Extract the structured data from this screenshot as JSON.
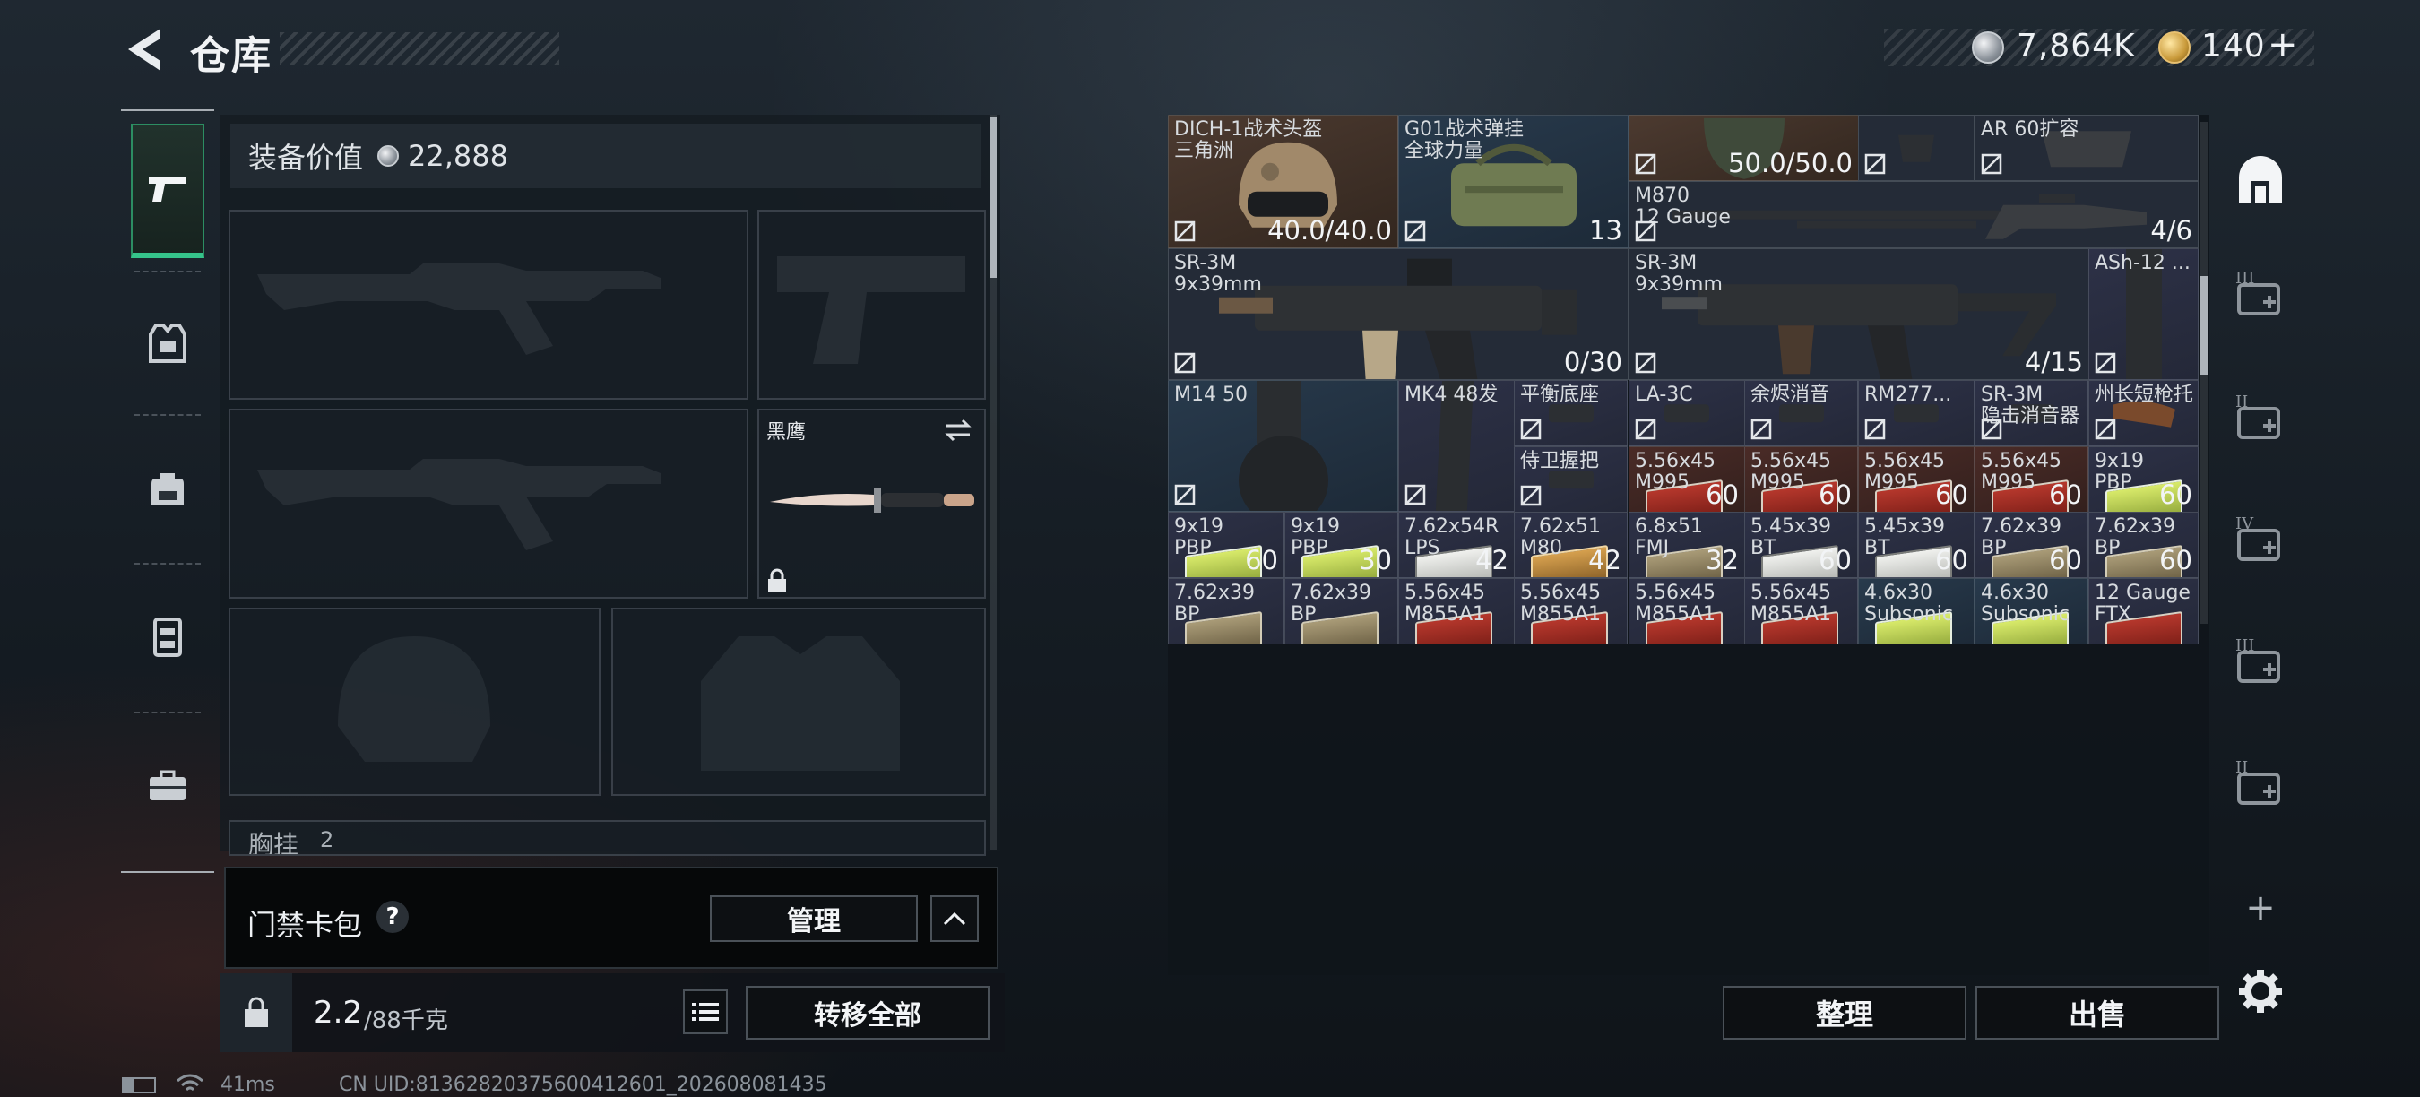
{
  "header": {
    "title": "仓库",
    "currency_silver": "7,864K",
    "currency_gold": "140",
    "currency_gold_add": "+"
  },
  "tabs": [
    {
      "name": "weapons",
      "icon": "pistol-icon"
    },
    {
      "name": "armor",
      "icon": "vest-icon"
    },
    {
      "name": "backpack",
      "icon": "backpack-icon"
    },
    {
      "name": "rig",
      "icon": "chest-rig-icon"
    },
    {
      "name": "case",
      "icon": "briefcase-icon"
    }
  ],
  "loadout": {
    "equipment_value_label": "装备价值",
    "equipment_value": "22,888",
    "melee_label": "黑鹰",
    "chest_rig_label": "胸挂",
    "chest_rig_count": "2",
    "keycard_label": "门禁卡包",
    "keycard_help": "?",
    "manage_label": "管理",
    "weight_current": "2.2",
    "weight_max": "/88千克",
    "transfer_all_label": "转移全部"
  },
  "stash": {
    "items": [
      {
        "name": "DICH-1战术头盔\n三角洲",
        "qty": "40.0/40.0",
        "rarity": "brown",
        "art": "helmet"
      },
      {
        "name": "G01战术弹挂\n全球力量",
        "qty": "13",
        "rarity": "blue",
        "art": "bag"
      },
      {
        "name": "",
        "qty": "50.0/50.0",
        "rarity": "brown",
        "art": "mask"
      },
      {
        "name": "",
        "qty": "",
        "rarity": "gray",
        "art": "grip"
      },
      {
        "name": "AR 60扩容",
        "qty": "",
        "rarity": "gray",
        "art": "mag"
      },
      {
        "name": "M870\n12 Gauge",
        "qty": "4/6",
        "rarity": "gray",
        "art": "shotgun"
      },
      {
        "name": "SR-3M\n9x39mm",
        "qty": "0/30",
        "rarity": "gray",
        "art": "rifle"
      },
      {
        "name": "SR-3M\n9x39mm",
        "qty": "4/15",
        "rarity": "gray",
        "art": "rifle2"
      },
      {
        "name": "ASh-12 ...",
        "qty": "",
        "rarity": "purple",
        "art": "mag2"
      },
      {
        "name": "M14 50",
        "qty": "",
        "rarity": "blue",
        "art": "drum"
      },
      {
        "name": "MK4 48发",
        "qty": "",
        "rarity": "purple",
        "art": "longmag"
      },
      {
        "name": "平衡底座",
        "qty": "",
        "rarity": "purple",
        "art": "part"
      },
      {
        "name": "LA-3C",
        "qty": "",
        "rarity": "purple",
        "art": "part"
      },
      {
        "name": "余烬消音",
        "qty": "",
        "rarity": "purple",
        "art": "part"
      },
      {
        "name": "RM277...",
        "qty": "",
        "rarity": "purple",
        "art": "part"
      },
      {
        "name": "SR-3M\n隐击消音器",
        "qty": "",
        "rarity": "purple",
        "art": "part"
      },
      {
        "name": "州长短枪托",
        "qty": "",
        "rarity": "purple",
        "art": "stock"
      },
      {
        "name": "侍卫握把",
        "qty": "",
        "rarity": "purple",
        "art": "part"
      },
      {
        "name": "5.56x45\nM995",
        "qty": "60",
        "rarity": "red",
        "art": "ammo-red"
      },
      {
        "name": "5.56x45\nM995",
        "qty": "60",
        "rarity": "red",
        "art": "ammo-red"
      },
      {
        "name": "5.56x45\nM995",
        "qty": "60",
        "rarity": "red",
        "art": "ammo-red"
      },
      {
        "name": "5.56x45\nM995",
        "qty": "60",
        "rarity": "red",
        "art": "ammo-red"
      },
      {
        "name": "9x19\nPBP",
        "qty": "60",
        "rarity": "purple",
        "art": "ammo-green"
      },
      {
        "name": "9x19\nPBP",
        "qty": "60",
        "rarity": "purple",
        "art": "ammo-green"
      },
      {
        "name": "9x19\nPBP",
        "qty": "30",
        "rarity": "purple",
        "art": "ammo-green"
      },
      {
        "name": "7.62x54R\nLPS",
        "qty": "42",
        "rarity": "purple",
        "art": "ammo-white"
      },
      {
        "name": "7.62x51\nM80",
        "qty": "42",
        "rarity": "purple",
        "art": "ammo-gold"
      },
      {
        "name": "6.8x51\nFMJ",
        "qty": "32",
        "rarity": "purple",
        "art": "ammo-tan"
      },
      {
        "name": "5.45x39\nBT",
        "qty": "60",
        "rarity": "purple",
        "art": "ammo-white"
      },
      {
        "name": "5.45x39\nBT",
        "qty": "60",
        "rarity": "purple",
        "art": "ammo-white"
      },
      {
        "name": "7.62x39\nBP",
        "qty": "60",
        "rarity": "purple",
        "art": "ammo-tan"
      },
      {
        "name": "7.62x39\nBP",
        "qty": "60",
        "rarity": "purple",
        "art": "ammo-tan"
      },
      {
        "name": "7.62x39\nBP",
        "qty": "",
        "rarity": "purple",
        "art": "ammo-tan"
      },
      {
        "name": "7.62x39\nBP",
        "qty": "",
        "rarity": "purple",
        "art": "ammo-tan"
      },
      {
        "name": "5.56x45\nM855A1",
        "qty": "",
        "rarity": "purple",
        "art": "ammo-red"
      },
      {
        "name": "5.56x45\nM855A1",
        "qty": "",
        "rarity": "purple",
        "art": "ammo-red"
      },
      {
        "name": "5.56x45\nM855A1",
        "qty": "",
        "rarity": "purple",
        "art": "ammo-red"
      },
      {
        "name": "5.56x45\nM855A1",
        "qty": "",
        "rarity": "purple",
        "art": "ammo-red"
      },
      {
        "name": "4.6x30\nSubsonic",
        "qty": "",
        "rarity": "blue",
        "art": "ammo-green"
      },
      {
        "name": "4.6x30\nSubsonic",
        "qty": "",
        "rarity": "blue",
        "art": "ammo-green"
      },
      {
        "name": "12 Gauge\nFTX",
        "qty": "",
        "rarity": "purple",
        "art": "ammo-red"
      }
    ],
    "sort_label": "整理",
    "sell_label": "出售"
  },
  "rail": {
    "add_label": "+",
    "case_labels": [
      "III",
      "II",
      "IV",
      "III",
      "II"
    ]
  },
  "status": {
    "ping": "41ms",
    "uid": "CN UID:8136282037560041260​1_202608081435"
  },
  "colors": {
    "accent_green": "#35c38a",
    "rarity_brown": "#4c3a30",
    "rarity_blue": "#283a4c",
    "rarity_purple": "#2d3147",
    "rarity_red": "#4a2b27"
  }
}
